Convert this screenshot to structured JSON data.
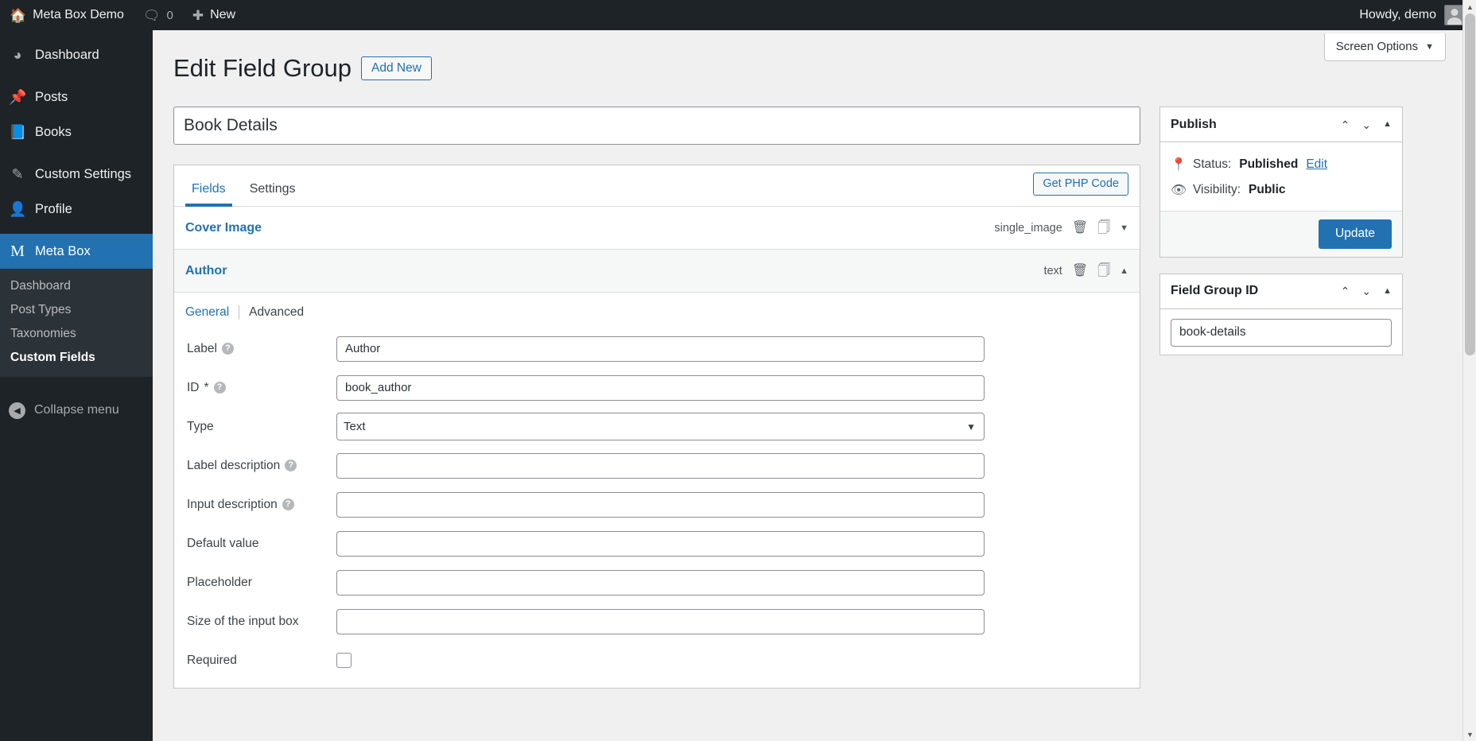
{
  "adminbar": {
    "site_icon": "home-icon",
    "site_name": "Meta Box Demo",
    "comments_icon": "comment-bubble-icon",
    "comments_count": "0",
    "new_icon": "plus-icon",
    "new_label": "New",
    "howdy": "Howdy, demo",
    "avatar": "user-avatar"
  },
  "sidebar": {
    "items": [
      {
        "label": "Dashboard",
        "icon": "dashboard-gauge-icon",
        "current": false
      },
      {
        "label": "Posts",
        "icon": "pushpin-icon",
        "current": false
      },
      {
        "label": "Books",
        "icon": "book-icon",
        "current": false
      },
      {
        "label": "Custom Settings",
        "icon": "pencil-icon",
        "current": false
      },
      {
        "label": "Profile",
        "icon": "user-icon",
        "current": false
      },
      {
        "label": "Meta Box",
        "icon": "metabox-m-icon",
        "current": true
      }
    ],
    "submenu": [
      {
        "label": "Dashboard",
        "current": false
      },
      {
        "label": "Post Types",
        "current": false
      },
      {
        "label": "Taxonomies",
        "current": false
      },
      {
        "label": "Custom Fields",
        "current": true
      }
    ],
    "collapse": {
      "label": "Collapse menu",
      "icon": "collapse-arrow-icon"
    }
  },
  "screen_meta": {
    "screen_options_label": "Screen Options",
    "caret_icon": "chevron-down-icon"
  },
  "page": {
    "title": "Edit Field Group",
    "add_new_label": "Add New",
    "group_title": "Book Details",
    "group_title_placeholder": "Enter title here"
  },
  "field_box": {
    "tabs": [
      {
        "label": "Fields",
        "active": true
      },
      {
        "label": "Settings",
        "active": false
      }
    ],
    "get_php_code_label": "Get PHP Code",
    "fields": [
      {
        "name": "Cover Image",
        "type_label": "single_image",
        "delete_icon": "trash-icon",
        "duplicate_icon": "copy-icon",
        "toggle_icon": "chevron-down-icon",
        "expanded": false
      },
      {
        "name": "Author",
        "type_label": "text",
        "delete_icon": "trash-icon",
        "duplicate_icon": "copy-icon",
        "toggle_icon": "chevron-up-icon",
        "expanded": true
      }
    ]
  },
  "field_editor": {
    "subtabs": [
      {
        "label": "General",
        "active": true
      },
      {
        "label": "Advanced",
        "active": false
      }
    ],
    "rows": [
      {
        "label": "Label",
        "help": true,
        "required": false,
        "control": "text",
        "value": "Author"
      },
      {
        "label": "ID",
        "help": true,
        "required": true,
        "control": "text",
        "value": "book_author"
      },
      {
        "label": "Type",
        "help": false,
        "required": false,
        "control": "select",
        "value": "Text"
      },
      {
        "label": "Label description",
        "help": true,
        "required": false,
        "control": "text",
        "value": ""
      },
      {
        "label": "Input description",
        "help": true,
        "required": false,
        "control": "text",
        "value": ""
      },
      {
        "label": "Default value",
        "help": false,
        "required": false,
        "control": "text",
        "value": ""
      },
      {
        "label": "Placeholder",
        "help": false,
        "required": false,
        "control": "text",
        "value": ""
      },
      {
        "label": "Size of the input box",
        "help": false,
        "required": false,
        "control": "text",
        "value": ""
      },
      {
        "label": "Required",
        "help": false,
        "required": false,
        "control": "checkbox",
        "value": ""
      }
    ],
    "help_glyph": "?",
    "required_marker": "*",
    "select_caret_icon": "chevron-down-icon"
  },
  "publish_box": {
    "title": "Publish",
    "move_up_icon": "chevron-up-icon",
    "move_down_icon": "chevron-down-icon",
    "toggle_icon": "triangle-up-icon",
    "status_icon": "pin-icon",
    "status_label": "Status:",
    "status_value": "Published",
    "status_edit_label": "Edit",
    "visibility_icon": "eye-icon",
    "visibility_label": "Visibility:",
    "visibility_value": "Public",
    "update_label": "Update"
  },
  "fgid_box": {
    "title": "Field Group ID",
    "move_up_icon": "chevron-up-icon",
    "move_down_icon": "chevron-down-icon",
    "toggle_icon": "triangle-up-icon",
    "value": "book-details",
    "placeholder": ""
  },
  "scrollbar": {
    "up_icon": "caret-up-icon",
    "down_icon": "caret-down-icon"
  },
  "colors": {
    "brand_blue": "#2271b1",
    "admin_dark": "#1d2327",
    "submenu_dark": "#2c3338",
    "page_bg": "#f0f0f1"
  }
}
